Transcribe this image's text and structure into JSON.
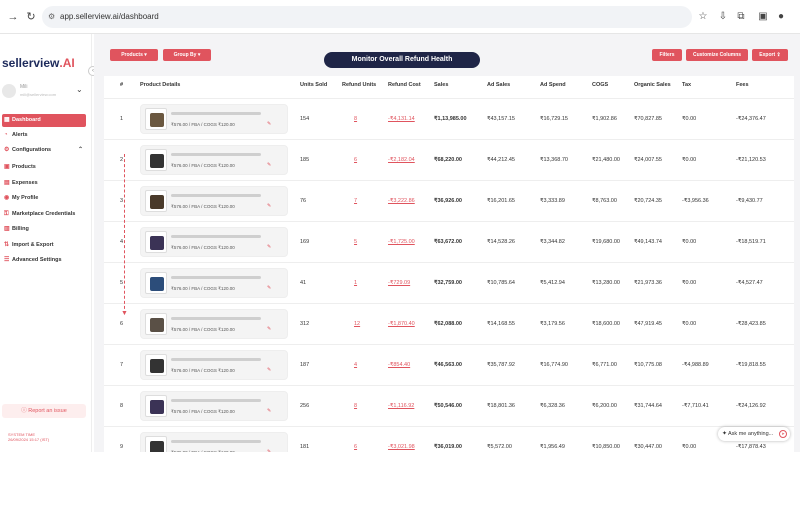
{
  "browser": {
    "url": "app.sellerview.ai/dashboard"
  },
  "sidebar": {
    "logo_main": "sellerview",
    "logo_suffix": ".AI",
    "user": {
      "name": "Mili",
      "email": "mili@sellerview.com"
    },
    "items": [
      {
        "label": "Dashboard",
        "icon": "dashboard-icon",
        "active": true
      },
      {
        "label": "Alerts",
        "icon": "bell-icon",
        "active": false
      },
      {
        "label": "Configurations",
        "icon": "gear-icon",
        "active": false
      },
      {
        "label": "Products",
        "icon": "box-icon",
        "active": false
      },
      {
        "label": "Expenses",
        "icon": "wallet-icon",
        "active": false
      },
      {
        "label": "My Profile",
        "icon": "user-icon",
        "active": false
      },
      {
        "label": "Marketplace Credentials",
        "icon": "key-icon",
        "active": false
      },
      {
        "label": "Billing",
        "icon": "billing-icon",
        "active": false
      },
      {
        "label": "Import & Export",
        "icon": "import-export-icon",
        "active": false
      },
      {
        "label": "Advanced Settings",
        "icon": "sliders-icon",
        "active": false
      }
    ],
    "report_issue": "Report an issue",
    "system_time_label": "SYSTEM TIME",
    "system_time_value": "26/09/2024 15:17 (IST)"
  },
  "toolbar": {
    "products": "Products",
    "group_by": "Group By",
    "banner": "Monitor Overall Refund Health",
    "filters": "Filters",
    "customize_columns": "Customize Columns",
    "export": "Export"
  },
  "table": {
    "headers": [
      "#",
      "Product Details",
      "Units Sold",
      "Refund Units",
      "Refund Cost",
      "Sales",
      "Ad Sales",
      "Ad Spend",
      "COGS",
      "Organic Sales",
      "Tax",
      "Fees"
    ],
    "rows": [
      {
        "n": "1",
        "sku": "₹576.00 / FBA / COGS ₹120.00",
        "units": "154",
        "refund_units": "8",
        "refund_cost": "-₹4,131.14",
        "sales": "₹1,13,985.00",
        "ad_sales": "₹43,157.15",
        "ad_spend": "₹16,729.15",
        "cogs": "₹1,902.86",
        "organic": "₹70,827.85",
        "tax": "₹0.00",
        "fees": "-₹24,376.47"
      },
      {
        "n": "2",
        "sku": "₹576.00 / FBA / COGS ₹120.00",
        "units": "185",
        "refund_units": "6",
        "refund_cost": "-₹2,182.04",
        "sales": "₹68,220.00",
        "ad_sales": "₹44,212.45",
        "ad_spend": "₹13,368.70",
        "cogs": "₹21,480.00",
        "organic": "₹24,007.55",
        "tax": "₹0.00",
        "fees": "-₹21,120.53"
      },
      {
        "n": "3",
        "sku": "₹576.00 / FBA / COGS ₹120.00",
        "units": "76",
        "refund_units": "7",
        "refund_cost": "-₹3,222.86",
        "sales": "₹36,926.00",
        "ad_sales": "₹16,201.65",
        "ad_spend": "₹3,333.89",
        "cogs": "₹8,763.00",
        "organic": "₹20,724.35",
        "tax": "-₹3,956.36",
        "fees": "-₹9,430.77"
      },
      {
        "n": "4",
        "sku": "₹576.00 / FBA / COGS ₹120.00",
        "units": "169",
        "refund_units": "5",
        "refund_cost": "-₹1,725.00",
        "sales": "₹63,672.00",
        "ad_sales": "₹14,528.26",
        "ad_spend": "₹3,344.82",
        "cogs": "₹19,680.00",
        "organic": "₹49,143.74",
        "tax": "₹0.00",
        "fees": "-₹18,519.71"
      },
      {
        "n": "5",
        "sku": "₹576.00 / FBA / COGS ₹120.00",
        "units": "41",
        "refund_units": "1",
        "refund_cost": "-₹729.09",
        "sales": "₹32,759.00",
        "ad_sales": "₹10,785.64",
        "ad_spend": "₹5,412.94",
        "cogs": "₹13,280.00",
        "organic": "₹21,973.36",
        "tax": "₹0.00",
        "fees": "-₹4,527.47"
      },
      {
        "n": "6",
        "sku": "₹576.00 / FBA / COGS ₹120.00",
        "units": "312",
        "refund_units": "12",
        "refund_cost": "-₹1,870.40",
        "sales": "₹62,088.00",
        "ad_sales": "₹14,168.55",
        "ad_spend": "₹3,179.56",
        "cogs": "₹18,600.00",
        "organic": "₹47,919.45",
        "tax": "₹0.00",
        "fees": "-₹28,423.85"
      },
      {
        "n": "7",
        "sku": "₹576.00 / FBA / COGS ₹120.00",
        "units": "187",
        "refund_units": "4",
        "refund_cost": "-₹854.40",
        "sales": "₹46,563.00",
        "ad_sales": "₹35,787.92",
        "ad_spend": "₹16,774.90",
        "cogs": "₹6,771.00",
        "organic": "₹10,775.08",
        "tax": "-₹4,988.89",
        "fees": "-₹19,818.55"
      },
      {
        "n": "8",
        "sku": "₹576.00 / FBA / COGS ₹120.00",
        "units": "256",
        "refund_units": "8",
        "refund_cost": "-₹1,116.92",
        "sales": "₹50,546.00",
        "ad_sales": "₹18,801.36",
        "ad_spend": "₹6,328.36",
        "cogs": "₹6,200.00",
        "organic": "₹31,744.64",
        "tax": "-₹7,710.41",
        "fees": "-₹24,126.92"
      },
      {
        "n": "9",
        "sku": "₹576.00 / FBA / COGS ₹120.00",
        "units": "181",
        "refund_units": "6",
        "refund_cost": "-₹3,021.98",
        "sales": "₹36,019.00",
        "ad_sales": "₹5,572.00",
        "ad_spend": "₹1,956.49",
        "cogs": "₹10,850.00",
        "organic": "₹30,447.00",
        "tax": "₹0.00",
        "fees": "-₹17,878.43"
      }
    ]
  },
  "assistant": {
    "label": "Ask me anything..."
  }
}
